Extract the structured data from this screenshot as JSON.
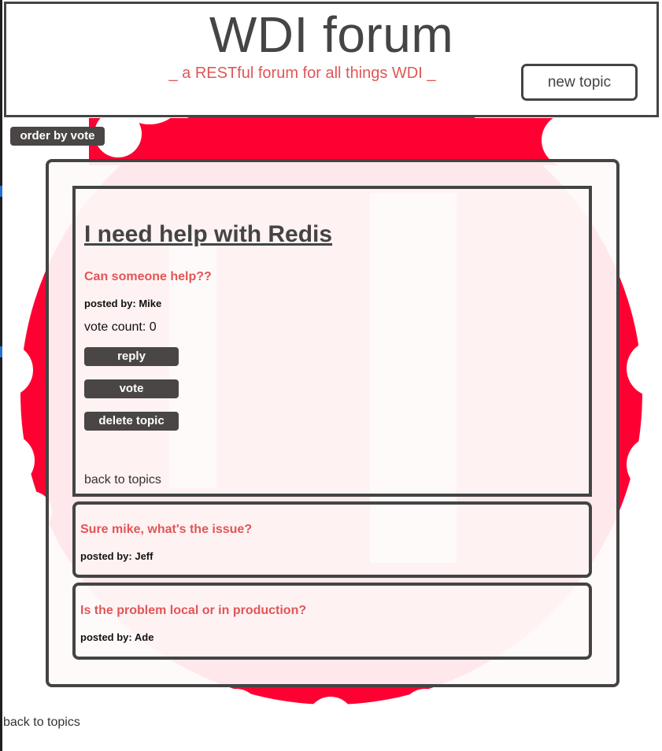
{
  "header": {
    "title": "WDI forum",
    "subtitle": "_ a RESTful forum for all things WDI _",
    "new_topic_label": "new topic"
  },
  "toolbar": {
    "order_label": "order by vote"
  },
  "topic": {
    "title": "I need help with Redis",
    "body": "Can someone help??",
    "author_prefix": "posted by: ",
    "author": "Mike",
    "vote_label": "vote count: ",
    "vote_count": "0",
    "reply_label": "reply",
    "vote_button_label": "vote",
    "delete_label": "delete topic",
    "back_label": "back to topics"
  },
  "replies": [
    {
      "body": "Sure mike, what's the issue?",
      "author_prefix": "posted by: ",
      "author": "Jeff"
    },
    {
      "body": "Is the problem local or in production?",
      "author_prefix": "posted by: ",
      "author": "Ade"
    }
  ],
  "footer": {
    "back_label": "back to topics"
  },
  "colors": {
    "accent": "#e15656",
    "logo_red": "#ff0033",
    "button_dark": "#4a4646",
    "border": "#444444"
  },
  "icons": {
    "background_logo": "ga-gear-logo"
  }
}
